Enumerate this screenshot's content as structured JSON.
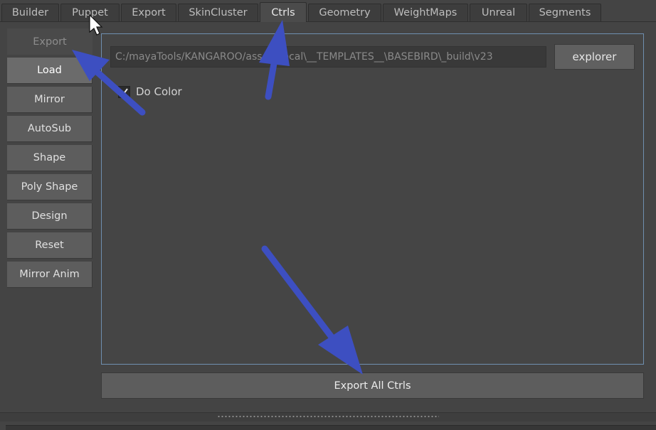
{
  "tabs": [
    {
      "label": "Builder"
    },
    {
      "label": "Puppet"
    },
    {
      "label": "Export"
    },
    {
      "label": "SkinCluster"
    },
    {
      "label": "Ctrls"
    },
    {
      "label": "Geometry"
    },
    {
      "label": "WeightMaps"
    },
    {
      "label": "Unreal"
    },
    {
      "label": "Segments"
    }
  ],
  "active_tab": "Ctrls",
  "sidebar": {
    "items": [
      {
        "label": "Export"
      },
      {
        "label": "Load"
      },
      {
        "label": "Mirror"
      },
      {
        "label": "AutoSub"
      },
      {
        "label": "Shape"
      },
      {
        "label": "Poly Shape"
      },
      {
        "label": "Design"
      },
      {
        "label": "Reset"
      },
      {
        "label": "Mirror Anim"
      }
    ]
  },
  "panel": {
    "path_value": "C:/mayaTools/KANGAROO/assetsLocal\\__TEMPLATES__\\BASEBIRD\\_build\\v23",
    "explorer_label": "explorer",
    "do_color_label": "Do Color",
    "do_color_checked": true,
    "export_all_label": "Export All Ctrls"
  },
  "colors": {
    "annotation_arrow": "#3d4fc1",
    "panel_border": "#6f8fb0"
  }
}
